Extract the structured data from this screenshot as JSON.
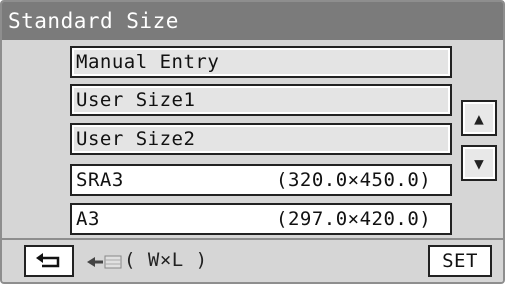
{
  "title": "Standard Size",
  "list_items": [
    {
      "label": "Manual Entry",
      "size": ""
    },
    {
      "label": "User Size1",
      "size": ""
    },
    {
      "label": "User Size2",
      "size": ""
    },
    {
      "label": "SRA3",
      "size": "(320.0×450.0)"
    },
    {
      "label": "A3",
      "size": "(297.0×420.0)"
    }
  ],
  "scroll": {
    "up_icon": "triangle-up-icon",
    "down_icon": "triangle-down-icon"
  },
  "bottom": {
    "back_icon": "return-arrow-icon",
    "feed_icon": "paper-feed-icon",
    "dimension_label": "( W×L )",
    "set_label": "SET"
  }
}
